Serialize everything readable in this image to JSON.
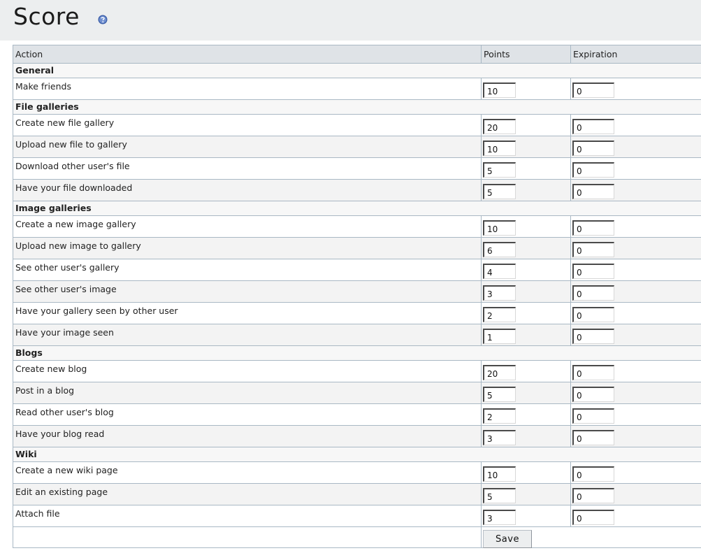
{
  "page": {
    "title": "Score",
    "help_icon": "help-question-icon"
  },
  "table": {
    "headers": [
      "Action",
      "Points",
      "Expiration"
    ],
    "sections": [
      {
        "title": "General",
        "items": [
          {
            "label": "Make friends",
            "points": "10",
            "expiration": "0"
          }
        ]
      },
      {
        "title": "File galleries",
        "items": [
          {
            "label": "Create new file gallery",
            "points": "20",
            "expiration": "0"
          },
          {
            "label": "Upload new file to gallery",
            "points": "10",
            "expiration": "0"
          },
          {
            "label": "Download other user's file",
            "points": "5",
            "expiration": "0"
          },
          {
            "label": "Have your file downloaded",
            "points": "5",
            "expiration": "0"
          }
        ]
      },
      {
        "title": "Image galleries",
        "items": [
          {
            "label": "Create a new image gallery",
            "points": "10",
            "expiration": "0"
          },
          {
            "label": "Upload new image to gallery",
            "points": "6",
            "expiration": "0"
          },
          {
            "label": "See other user's gallery",
            "points": "4",
            "expiration": "0"
          },
          {
            "label": "See other user's image",
            "points": "3",
            "expiration": "0"
          },
          {
            "label": "Have your gallery seen by other user",
            "points": "2",
            "expiration": "0"
          },
          {
            "label": "Have your image seen",
            "points": "1",
            "expiration": "0"
          }
        ]
      },
      {
        "title": "Blogs",
        "items": [
          {
            "label": "Create new blog",
            "points": "20",
            "expiration": "0"
          },
          {
            "label": "Post in a blog",
            "points": "5",
            "expiration": "0"
          },
          {
            "label": "Read other user's blog",
            "points": "2",
            "expiration": "0"
          },
          {
            "label": "Have your blog read",
            "points": "3",
            "expiration": "0"
          }
        ]
      },
      {
        "title": "Wiki",
        "items": [
          {
            "label": "Create a new wiki page",
            "points": "10",
            "expiration": "0"
          },
          {
            "label": "Edit an existing page",
            "points": "5",
            "expiration": "0"
          },
          {
            "label": "Attach file",
            "points": "3",
            "expiration": "0"
          }
        ]
      }
    ],
    "save_label": "Save"
  },
  "colors": {
    "header_bg": "#eceeef",
    "table_header_bg": "#dfe3e7",
    "border": "#a9b8c4",
    "help_icon": "#3b5ea8"
  }
}
